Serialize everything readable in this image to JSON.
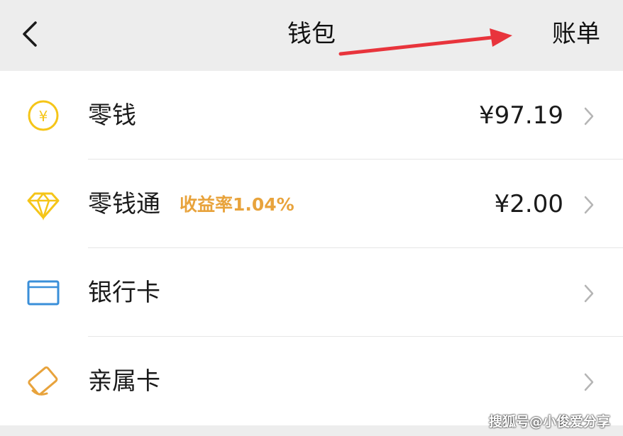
{
  "header": {
    "back_icon": "chevron-left-icon",
    "title": "钱包",
    "bill_label": "账单"
  },
  "annotation": {
    "arrow_color": "#e8343c",
    "points_to": "bill-link"
  },
  "rows": [
    {
      "icon": "yen-coin-icon",
      "label": "零钱",
      "sublabel": "",
      "value": "¥97.19",
      "icon_color": "#f5c518"
    },
    {
      "icon": "diamond-icon",
      "label": "零钱通",
      "sublabel": "收益率1.04%",
      "value": "¥2.00",
      "icon_color": "#f5c518"
    },
    {
      "icon": "bank-card-icon",
      "label": "银行卡",
      "sublabel": "",
      "value": "",
      "icon_color": "#3a8fd9"
    },
    {
      "icon": "family-card-icon",
      "label": "亲属卡",
      "sublabel": "",
      "value": "",
      "icon_color": "#e8a33c"
    }
  ],
  "colors": {
    "header_bg": "#ededed",
    "yield_text": "#e8a33c",
    "chevron": "#b5b5b5"
  },
  "watermark": "搜狐号@小俊爱分享"
}
